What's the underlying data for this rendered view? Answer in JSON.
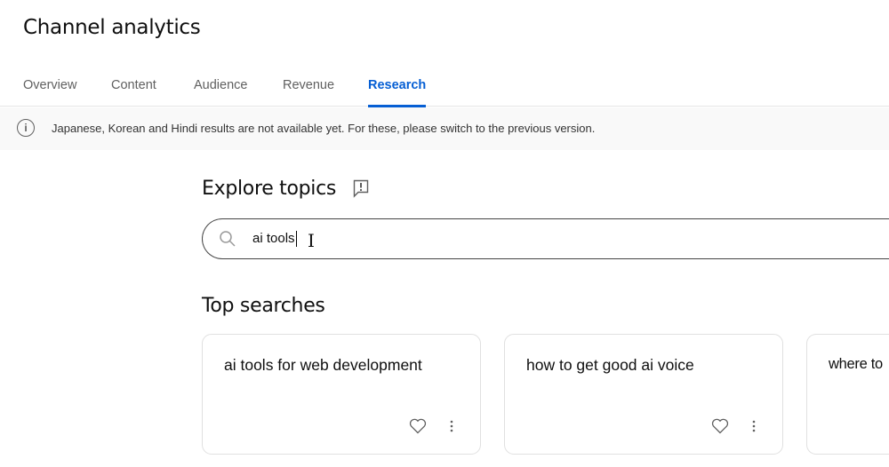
{
  "header": {
    "title": "Channel analytics"
  },
  "tabs": [
    {
      "label": "Overview"
    },
    {
      "label": "Content"
    },
    {
      "label": "Audience"
    },
    {
      "label": "Revenue"
    },
    {
      "label": "Research",
      "active": true
    }
  ],
  "notice": {
    "icon": "info-icon",
    "text": "Japanese, Korean and Hindi results are not available yet. For these, please switch to the previous version."
  },
  "explore": {
    "title": "Explore topics",
    "feedback_icon": "feedback-icon"
  },
  "search": {
    "value": "ai tools",
    "icon": "search-icon"
  },
  "top_searches": {
    "title": "Top searches",
    "cards": [
      {
        "title": "ai tools for web development"
      },
      {
        "title": "how to get good ai voice"
      },
      {
        "title": "where to"
      }
    ]
  },
  "colors": {
    "accent": "#065fd4",
    "notice_bg": "#f9f9f9"
  }
}
